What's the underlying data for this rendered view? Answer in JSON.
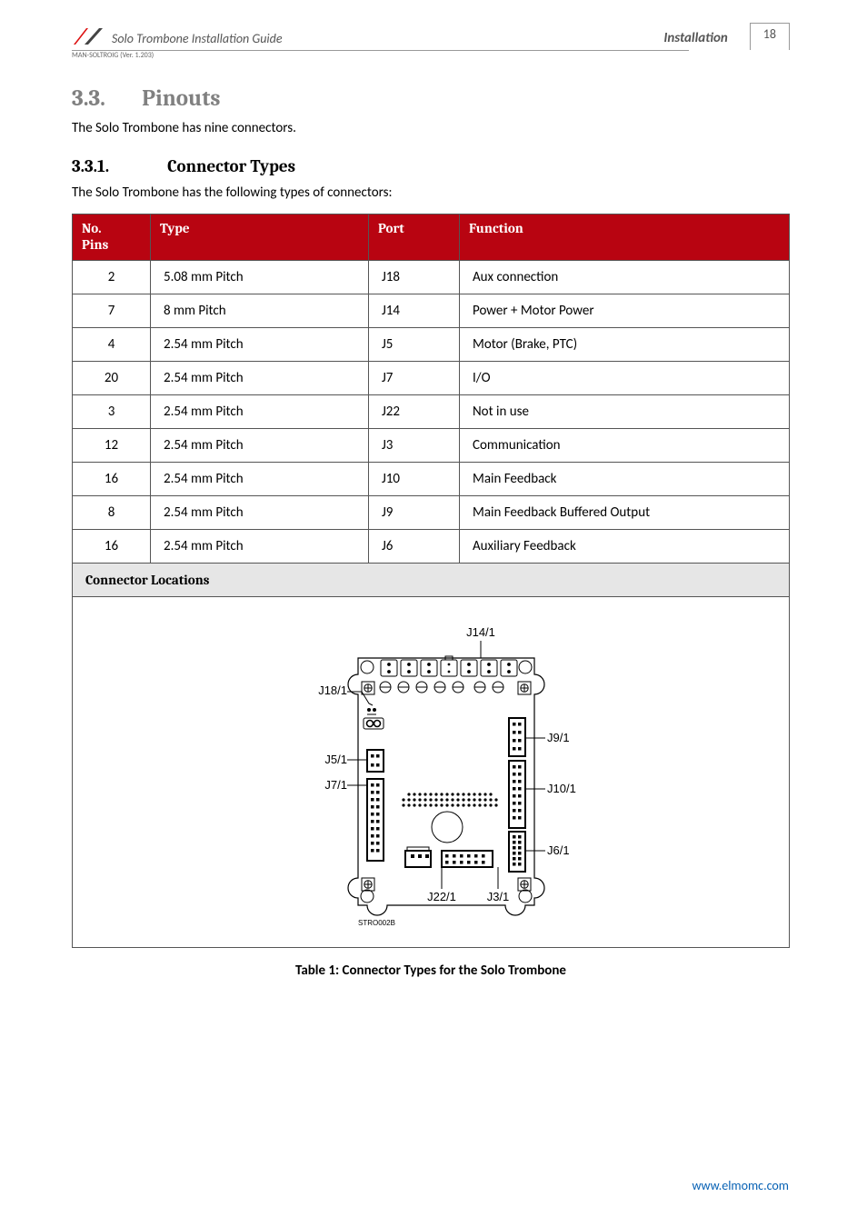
{
  "header": {
    "doc_title": "Solo Trombone Installation Guide",
    "section_label": "Installation",
    "page_number": "18",
    "version_text": "MAN-SOLTROIG (Ver. 1.203)"
  },
  "section": {
    "number": "3.3.",
    "title": "Pinouts",
    "intro": "The Solo Trombone has nine connectors."
  },
  "subsection": {
    "number": "3.3.1.",
    "title": "Connector Types",
    "intro": "The Solo Trombone has the following types of connectors:"
  },
  "table": {
    "headers": {
      "pins": "No. Pins",
      "type": "Type",
      "port": "Port",
      "function": "Function"
    },
    "rows": [
      {
        "pins": "2",
        "type": "5.08 mm Pitch",
        "port": "J18",
        "function": "Aux connection"
      },
      {
        "pins": "7",
        "type": "8 mm Pitch",
        "port": "J14",
        "function": "Power + Motor Power"
      },
      {
        "pins": "4",
        "type": "2.54 mm Pitch",
        "port": "J5",
        "function": "Motor (Brake, PTC)"
      },
      {
        "pins": "20",
        "type": "2.54 mm Pitch",
        "port": "J7",
        "function": "I/O"
      },
      {
        "pins": "3",
        "type": "2.54 mm Pitch",
        "port": "J22",
        "function": "Not in use"
      },
      {
        "pins": "12",
        "type": "2.54 mm Pitch",
        "port": "J3",
        "function": "Communication"
      },
      {
        "pins": "16",
        "type": "2.54 mm Pitch",
        "port": "J10",
        "function": "Main Feedback"
      },
      {
        "pins": "8",
        "type": "2.54 mm Pitch",
        "port": "J9",
        "function": "Main Feedback Buffered Output"
      },
      {
        "pins": "16",
        "type": "2.54 mm Pitch",
        "port": "J6",
        "function": "Auxiliary Feedback"
      }
    ],
    "locations_header": "Connector Locations"
  },
  "diagram": {
    "labels": {
      "j14": "J14/1",
      "j18": "J18/1",
      "j5": "J5/1",
      "j7": "J7/1",
      "j9": "J9/1",
      "j10": "J10/1",
      "j6": "J6/1",
      "j22": "J22/1",
      "j3": "J3/1"
    },
    "footer_code": "STRO002B"
  },
  "caption": "Table 1: Connector Types for the Solo Trombone",
  "footer": {
    "url_text": "www.elmomc.com"
  }
}
